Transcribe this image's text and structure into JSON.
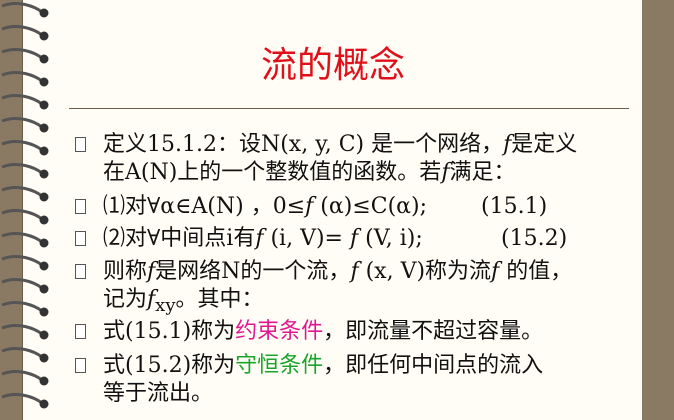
{
  "title": "流的概念",
  "items": [
    {
      "line1": [
        "定义15.1.2：设N(x, y, C) 是一个网络，",
        "f",
        "是定义"
      ],
      "line2": [
        "在A(N)上的一个整数值的函数。若",
        "f",
        "满足："
      ]
    },
    {
      "label": "⑴对∀α∈A(N) ，0≤",
      "f": "f",
      "rest": " (α)≤C(α);",
      "eq": "(15.1)"
    },
    {
      "label": "⑵对∀中间点i有",
      "f1": "f",
      "mid": " (i, V)= ",
      "f2": "f",
      "rest": " (V, i);",
      "eq": "(15.2)"
    },
    {
      "line1a": "则称",
      "f1": "f",
      "line1b": "是网络N的一个流，",
      "f2": "f",
      "line1c": " (x, V)称为流",
      "f3": "f",
      "line1d": " 的值，",
      "line2a": "记为",
      "f4": "f",
      "sub": "xy",
      "line2b": "。其中："
    },
    {
      "a": "式(15.1)称为",
      "hl": "约束条件",
      "b": "，即流量不超过容量。"
    },
    {
      "a": "式(15.2)称为",
      "hl": "守恒条件",
      "b": "，即任何中间点的流入",
      "line2": "等于流出。"
    }
  ]
}
